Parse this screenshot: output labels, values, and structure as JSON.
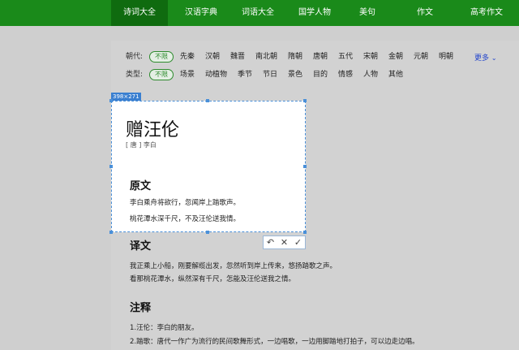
{
  "nav": {
    "items": [
      {
        "label": "诗词大全",
        "active": true
      },
      {
        "label": "汉语字典",
        "active": false
      },
      {
        "label": "词语大全",
        "active": false
      },
      {
        "label": "国学人物",
        "active": false
      },
      {
        "label": "美句",
        "active": false
      },
      {
        "label": "作文",
        "active": false
      },
      {
        "label": "高考作文",
        "active": false
      }
    ]
  },
  "filters": {
    "dynasty": {
      "label": "朝代:",
      "selected": "不限",
      "options": [
        "先秦",
        "汉朝",
        "魏晋",
        "南北朝",
        "隋朝",
        "唐朝",
        "五代",
        "宋朝",
        "金朝",
        "元朝",
        "明朝"
      ]
    },
    "type": {
      "label": "类型:",
      "selected": "不限",
      "options": [
        "场景",
        "动植物",
        "季节",
        "节日",
        "景色",
        "目的",
        "情感",
        "人物",
        "其他"
      ]
    },
    "more_label": "更多"
  },
  "selection": {
    "size_label": "398×271"
  },
  "poem": {
    "title": "赠汪伦",
    "author": "[ 唐 ] 李白",
    "original_heading": "原文",
    "original_lines": [
      "李白乘舟将欲行，忽闻岸上踏歌声。",
      "桃花潭水深千尺，不及汪伦送我情。"
    ],
    "translation_heading": "译文",
    "translation_lines": [
      "我正乘上小船，刚要解缆出发，忽然听到岸上传来，悠扬踏歌之声。",
      "看那桃花潭水，纵然深有千尺，怎能及汪伦送我之情。"
    ],
    "notes_heading": "注释",
    "notes_lines": [
      "1.汪伦：李白的朋友。",
      "2.踏歌：唐代一作广为流行的民间歌舞形式，一边唱歌，一边用脚踏地打拍子，可以边走边唱。"
    ]
  },
  "toolbar": {
    "undo_icon": "↶",
    "close_icon": "✕",
    "confirm_icon": "✓"
  },
  "colors": {
    "nav_bg": "#1a8a1a",
    "nav_active": "#0f6b0f",
    "selection_border": "#4a90d9",
    "pill_green": "#2e8b2e",
    "more_link": "#2244cc"
  }
}
